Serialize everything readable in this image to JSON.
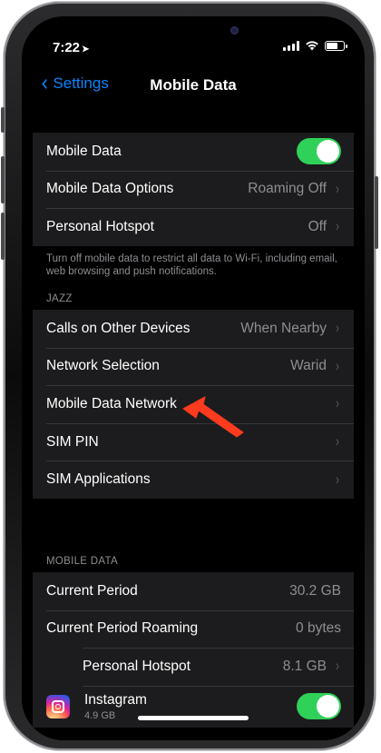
{
  "status_bar": {
    "time": "7:22",
    "location_icon": "location-arrow-icon",
    "signal_icon": "cellular-signal-icon",
    "wifi_icon": "wifi-icon",
    "battery_icon": "battery-icon",
    "battery_level": 0.75
  },
  "navbar": {
    "back_label": "Settings",
    "back_icon": "chevron-left-icon",
    "title": "Mobile Data"
  },
  "group1": {
    "rows": [
      {
        "label": "Mobile Data",
        "toggle_on": true
      },
      {
        "label": "Mobile Data Options",
        "value": "Roaming Off"
      },
      {
        "label": "Personal Hotspot",
        "value": "Off"
      }
    ],
    "footnote": "Turn off mobile data to restrict all data to Wi-Fi, including email, web browsing and push notifications."
  },
  "group2": {
    "header": "JAZZ",
    "rows": [
      {
        "label": "Calls on Other Devices",
        "value": "When Nearby"
      },
      {
        "label": "Network Selection",
        "value": "Warid"
      },
      {
        "label": "Mobile Data Network",
        "value": ""
      },
      {
        "label": "SIM PIN",
        "value": ""
      },
      {
        "label": "SIM Applications",
        "value": ""
      }
    ]
  },
  "group3": {
    "header": "MOBILE DATA",
    "rows": [
      {
        "label": "Current Period",
        "value": "30.2 GB"
      },
      {
        "label": "Current Period Roaming",
        "value": "0 bytes"
      },
      {
        "label": "Personal Hotspot",
        "value": "8.1 GB"
      }
    ],
    "app": {
      "name": "Instagram",
      "usage": "4.9 GB",
      "icon": "instagram-icon",
      "toggle_on": true
    }
  },
  "annotation": {
    "arrow_color": "#ff3b1f"
  },
  "colors": {
    "accent": "#0a84ff",
    "toggle_on": "#30d158",
    "cell_bg": "#1c1c1e",
    "secondary_text": "#8e8e93"
  }
}
